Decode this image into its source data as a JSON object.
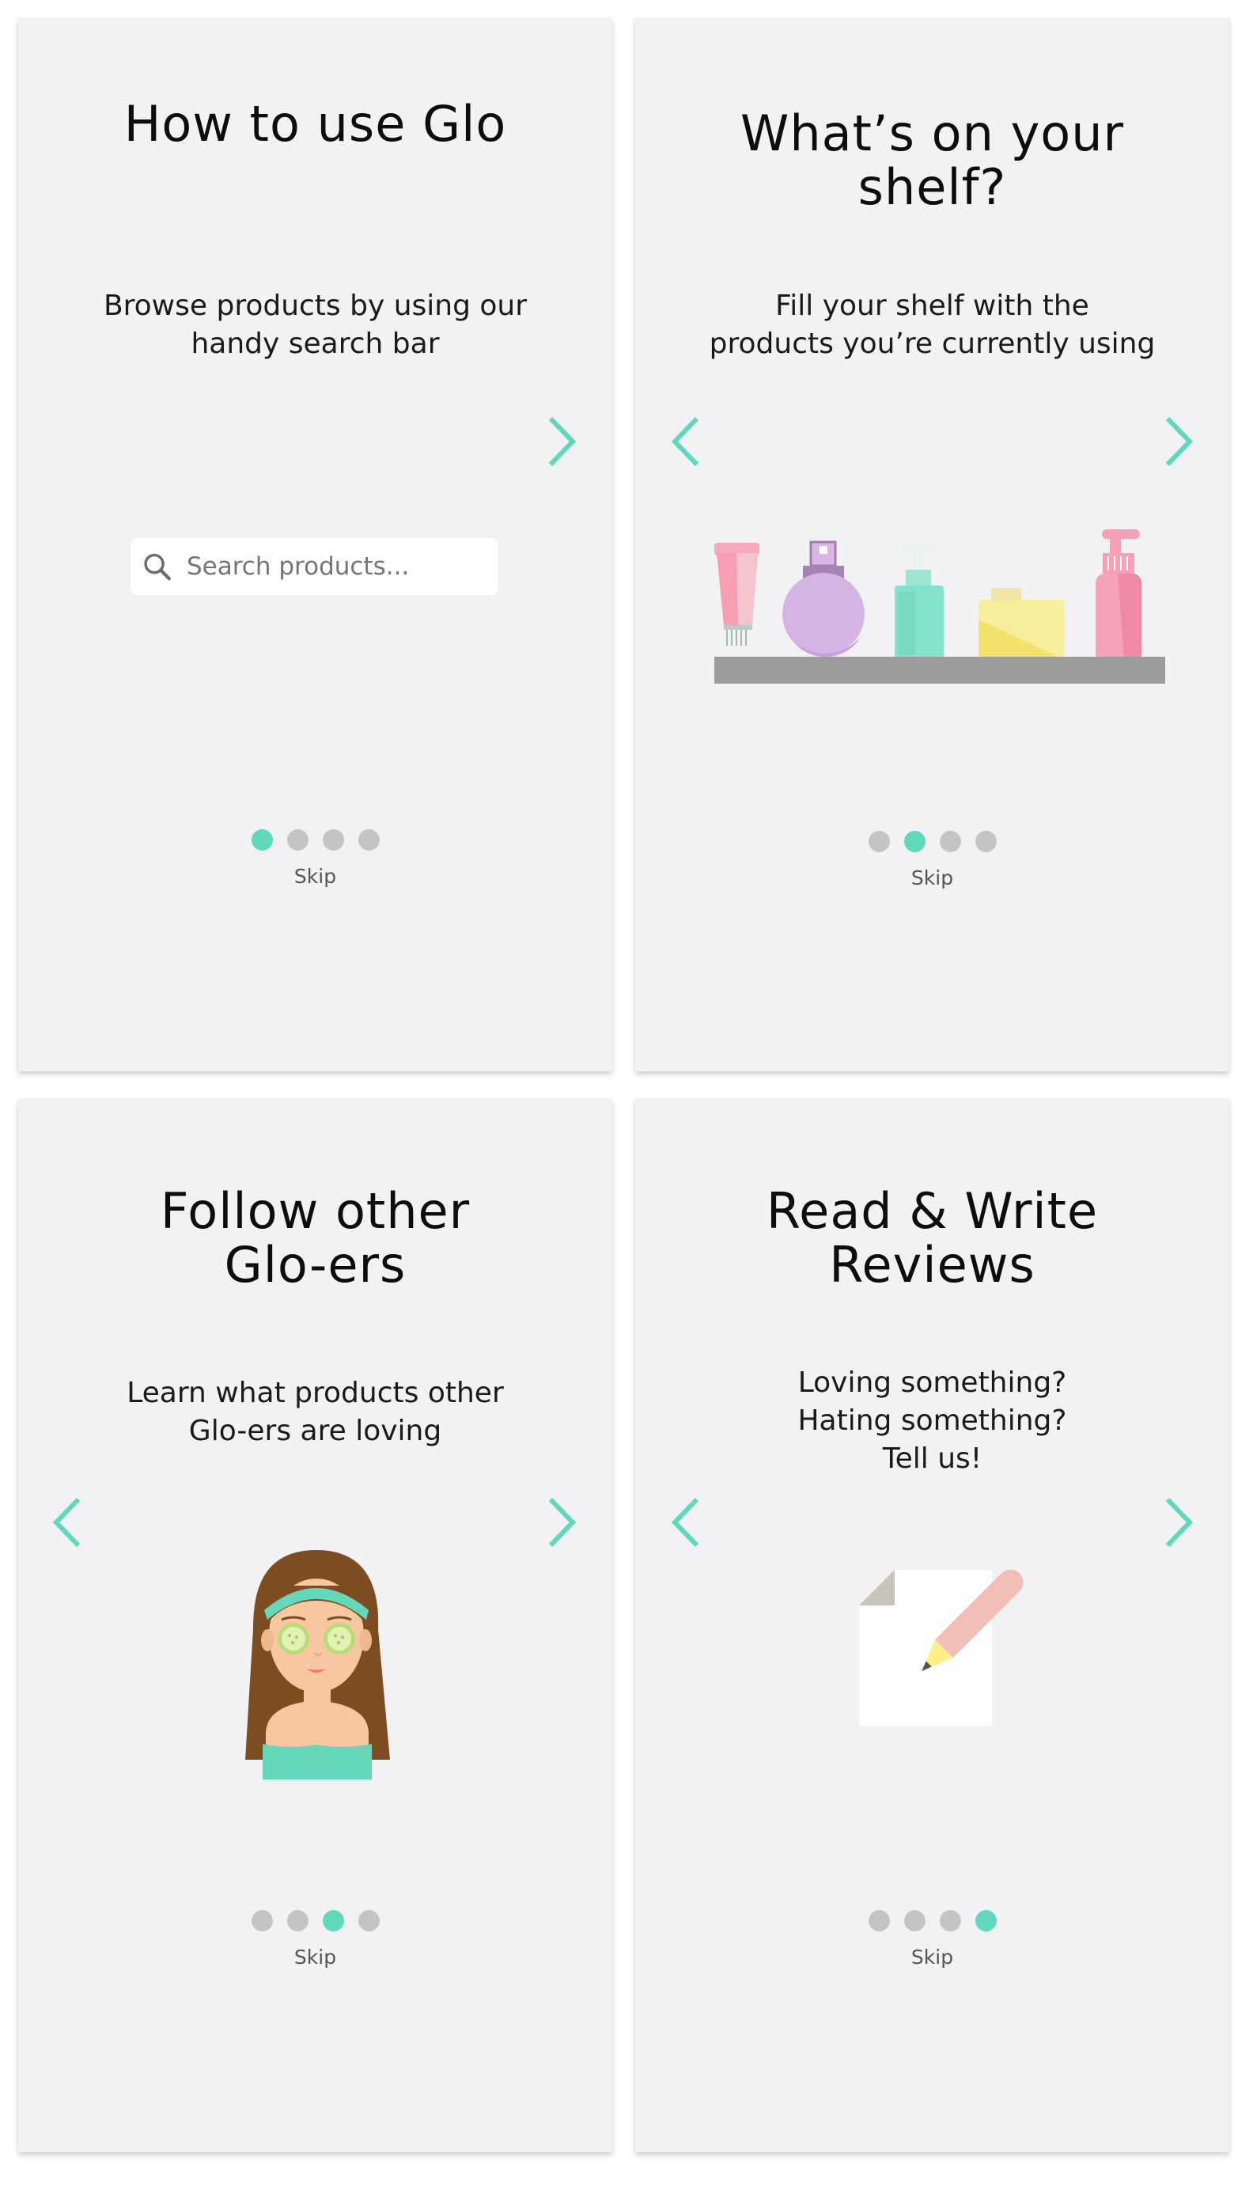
{
  "screens": [
    {
      "title": "How to use Glo",
      "subtitle_lines": [
        "Browse products by using our",
        "handy search bar"
      ],
      "search": {
        "placeholder": "Search products..."
      },
      "active_dot": 1,
      "skip_label": "Skip"
    },
    {
      "title_lines": [
        "What’s on your",
        "shelf?"
      ],
      "subtitle_lines": [
        "Fill your shelf with the",
        "products you’re currently using"
      ],
      "active_dot": 2,
      "skip_label": "Skip"
    },
    {
      "title_lines": [
        "Follow other",
        "Glo-ers"
      ],
      "subtitle_lines": [
        "Learn what products other",
        "Glo-ers are loving"
      ],
      "active_dot": 3,
      "skip_label": "Skip"
    },
    {
      "title_lines": [
        "Read & Write",
        "Reviews"
      ],
      "subtitle_lines": [
        "Loving something?",
        "Hating something?",
        "Tell us!"
      ],
      "active_dot": 4,
      "skip_label": "Skip"
    }
  ],
  "icons": {
    "next": "chevron-right-icon",
    "prev": "chevron-left-icon",
    "search": "search-icon"
  },
  "colors": {
    "accent": "#5fd8bd",
    "card_background": "#f2f2f4",
    "dot_inactive": "#c4c4c6"
  }
}
